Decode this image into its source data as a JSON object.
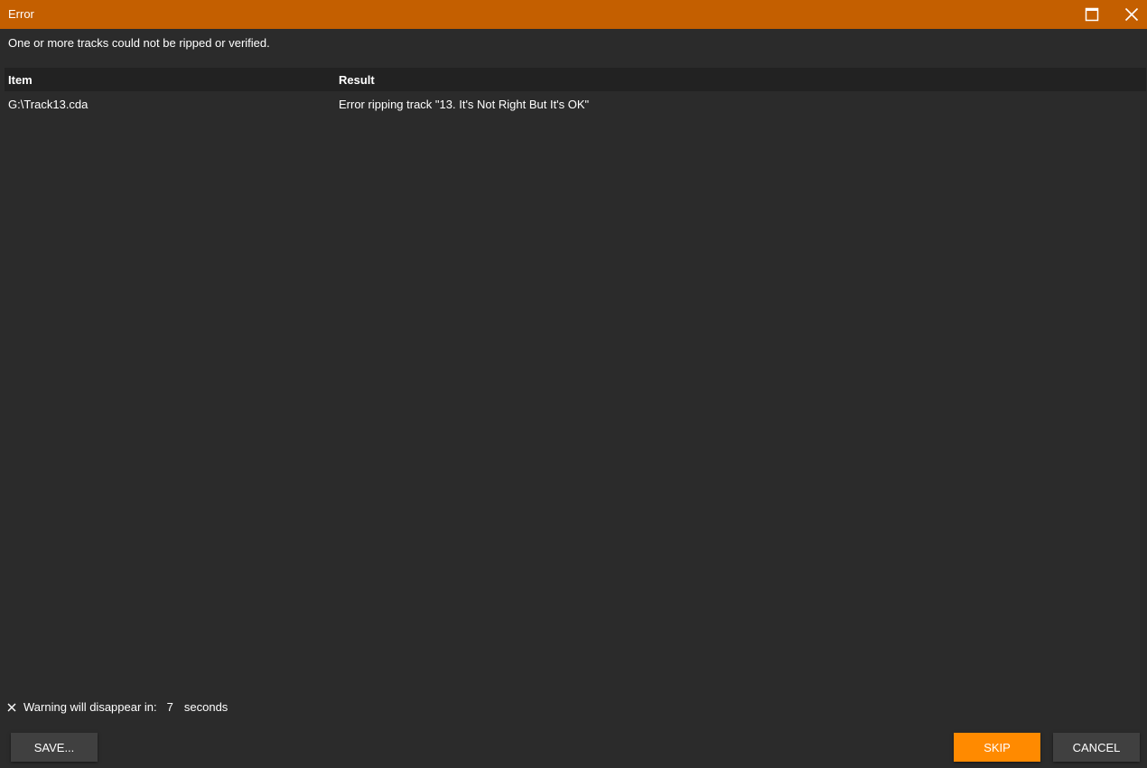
{
  "window": {
    "title": "Error",
    "accent_color": "#c45f00",
    "background_color": "#2b2b2b"
  },
  "message": "One or more tracks could not be ripped or verified.",
  "table": {
    "columns": [
      "Item",
      "Result"
    ],
    "rows": [
      {
        "item": "G:\\Track13.cda",
        "result": "Error ripping track \"13. It's Not Right But It's OK\""
      }
    ]
  },
  "countdown": {
    "prefix": "Warning will disappear in:",
    "value": "7",
    "unit": "seconds"
  },
  "buttons": {
    "save": "SAVE...",
    "skip": "SKIP",
    "cancel": "CANCEL",
    "skip_color": "#ff8a00"
  },
  "icons": {
    "maximize": "maximize-icon",
    "close": "close-icon",
    "dismiss": "dismiss-warning-icon"
  }
}
